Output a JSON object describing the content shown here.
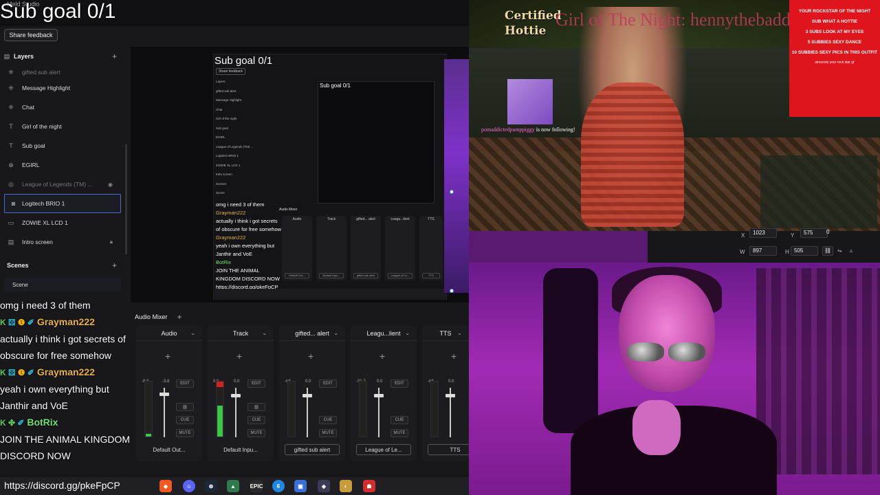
{
  "app": {
    "title": "Meld Studio",
    "share_feedback": "Share feedback"
  },
  "overlay": {
    "sub_goal": "Sub goal 0/1"
  },
  "layers": {
    "header": "Layers",
    "items": [
      {
        "label": "gifted sub alert"
      },
      {
        "label": "Message Highlight"
      },
      {
        "label": "Chat"
      },
      {
        "label": "Girl of the night"
      },
      {
        "label": "Sub goal"
      },
      {
        "label": "EGIRL"
      },
      {
        "label": "League of Legends (TM) ..."
      },
      {
        "label": "Logitech BRIO 1"
      },
      {
        "label": "ZOWIE XL LCD 1"
      },
      {
        "label": "Intro screen"
      }
    ]
  },
  "scenes": {
    "header": "Scenes",
    "items": [
      {
        "label": "Scene"
      }
    ]
  },
  "nested_preview": {
    "title": "Sub goal 0/1",
    "share": "Share feedback",
    "inner_title": "Sub goal 0/1",
    "layers": [
      "Layers",
      "gifted sub alert",
      "Message Highlight",
      "Chat",
      "Girl of the night",
      "Sub goal",
      "EGIRL",
      "League of Legends (TM) ...",
      "Logitech BRIO 1",
      "ZOWIE XL LCD 1",
      "Intro screen",
      "Scenes",
      "Scene"
    ],
    "chat": [
      "omg i need 3 of them",
      "Grayman222",
      "actually i think i got secrets of obscure for free somehow",
      "Grayman222",
      "yeah i own everything but Janthir and VoE",
      "BotRix",
      "JOIN THE ANIMAL KINGDOM DISCORD NOW",
      "https://discord.gg/pkeFpCP"
    ],
    "mixer_title": "Audio Mixer",
    "channels": [
      "Audio",
      "Track",
      "gifted... alert",
      "Leagu...lient",
      "TTS"
    ],
    "sources": [
      "Default Out...",
      "Default Inpu...",
      "gifted sub alert",
      "League of Le...",
      "TTS"
    ]
  },
  "chat": {
    "lines": [
      {
        "text": "omg i need 3 of them"
      },
      {
        "user": "Grayman222",
        "text": "actually i think i got secrets of obscure for free somehow"
      },
      {
        "user": "Grayman222",
        "text": "yeah i own everything but Janthir and VoE"
      },
      {
        "user": "BotRix",
        "text": "JOIN THE ANIMAL KINGDOM DISCORD NOW"
      }
    ],
    "link": "https://discord.gg/pkeFpCP"
  },
  "audio_mixer": {
    "title": "Audio Mixer",
    "channels": [
      {
        "name": "Audio",
        "vol_l": "-8.8",
        "vol_r": "-3.8",
        "source": "Default Out...",
        "level": 0.05,
        "fader": 0.9,
        "clip": false
      },
      {
        "name": "Track",
        "vol_l": "0.0",
        "vol_r": "0.0",
        "source": "Default Inpu...",
        "level": 0.55,
        "fader": 0.88,
        "clip": true
      },
      {
        "name": "gifted... alert",
        "vol_l": "-inf",
        "vol_r": "0.0",
        "source": "gifted sub alert",
        "level": 0,
        "fader": 0.88,
        "clip": false
      },
      {
        "name": "Leagu...lient",
        "vol_l": "-31.7",
        "vol_r": "0.0",
        "source": "League of Le...",
        "level": 0,
        "fader": 0.88,
        "clip": false
      },
      {
        "name": "TTS",
        "vol_l": "-inf",
        "vol_r": "0.0",
        "source": "TTS",
        "level": 0,
        "fader": 0.88,
        "clip": false
      }
    ],
    "btn_edit": "EDIT",
    "btn_cue": "CUE",
    "btn_mute": "MUTE"
  },
  "stream": {
    "certified": [
      "Certified",
      "Hottie"
    ],
    "girl_of_night": "Girl of The Night: hennythebadd",
    "follow_user": "pomaddictedpumppiggy",
    "follow_text": "is now following!",
    "promo": [
      "YOUR ROCKSTAR OF THE NIGHT",
      "SUB WHAT A HOTTIE",
      "3 SUBS LOOK AT MY EYES",
      "5 SUBBIES SEXY DANCE",
      "10 SUBBIES SEXY PICS IN THIS OUTFIT",
      "sincerely your rock star gf"
    ]
  },
  "transform": {
    "x_label": "X",
    "x": "1023",
    "y_label": "Y",
    "y": "575",
    "r": "0",
    "w_label": "W",
    "w": "897",
    "h_label": "H",
    "h": "505"
  },
  "taskbar": {
    "icons": [
      "brave-icon",
      "discord-icon",
      "steam-icon",
      "meld-icon",
      "epic-icon",
      "battlenet-icon",
      "app-icon",
      "riot-icon",
      "league-icon",
      "game-icon"
    ],
    "labels": [
      "EPIC"
    ]
  }
}
